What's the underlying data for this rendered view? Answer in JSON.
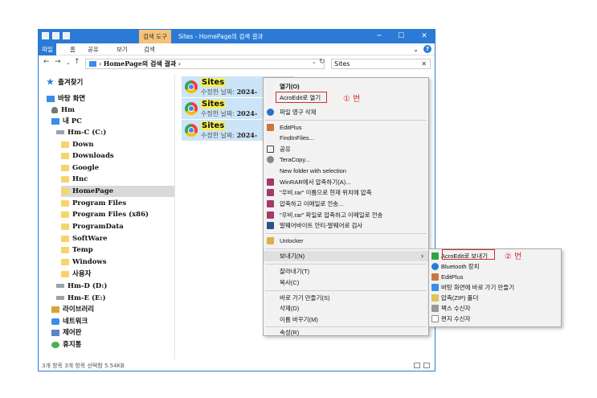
{
  "titlebar": {
    "context_tab": "검색 도구",
    "title": "Sites - HomePage의 검색 결과",
    "minimize": "─",
    "maximize": "☐",
    "close": "✕"
  },
  "ribbon": {
    "tabs": [
      "파일",
      "홈",
      "공유",
      "보기",
      "검색"
    ],
    "collapse": "⌄",
    "help": "?"
  },
  "address": {
    "back": "←",
    "forward": "→",
    "recent": "⌄",
    "up": "↑",
    "sep": "›",
    "folder": "HomePage의 검색 결과",
    "after": "›",
    "dropdown": "⌄",
    "refresh": "↻",
    "search_value": "Sites",
    "search_clear": "✕"
  },
  "nav": {
    "items": [
      {
        "label": "즐겨찾기"
      },
      {
        "label": "바탕 화면"
      },
      {
        "label": "Hm"
      },
      {
        "label": "내 PC"
      },
      {
        "label": "Hm-C (C:)"
      },
      {
        "label": "Down"
      },
      {
        "label": "Downloads"
      },
      {
        "label": "Google"
      },
      {
        "label": "Hnc"
      },
      {
        "label": "HomePage"
      },
      {
        "label": "Program Files"
      },
      {
        "label": "Program Files (x86)"
      },
      {
        "label": "ProgramData"
      },
      {
        "label": "SoftWare"
      },
      {
        "label": "Temp"
      },
      {
        "label": "Windows"
      },
      {
        "label": "사용자"
      },
      {
        "label": "Hm-D (D:)"
      },
      {
        "label": "Hm-E (E:)"
      },
      {
        "label": "라이브러리"
      },
      {
        "label": "네트워크"
      },
      {
        "label": "제어판"
      },
      {
        "label": "휴지통"
      }
    ]
  },
  "results": [
    {
      "name": "Sites",
      "meta_label": "수정한 날짜:",
      "meta_value": "2024-"
    },
    {
      "name": "Sites",
      "meta_label": "수정한 날짜:",
      "meta_value": "2024-"
    },
    {
      "name": "Sites",
      "meta_label": "수정한 날짜:",
      "meta_value": "2024-"
    }
  ],
  "status": {
    "text": "3개 항목   3개 항목 선택함 5.54KB"
  },
  "context_menu": {
    "items": [
      {
        "label": "열기(O)"
      },
      {
        "label": "AcroEdit로 열기"
      },
      {
        "label": "파일 영구 삭제"
      },
      {
        "label": "EditPlus"
      },
      {
        "label": "FindInFiles..."
      },
      {
        "label": "공유"
      },
      {
        "label": "TeraCopy..."
      },
      {
        "label": "New folder with selection"
      },
      {
        "label": "WinRAR에서 압축하기(A)..."
      },
      {
        "label": "\"우비.rar\" 이름으로 현재 위치에 압축"
      },
      {
        "label": "압축하고 이메일로 전송..."
      },
      {
        "label": "\"우비.rar\" 파일로 압축하고 이메일로 전송"
      },
      {
        "label": "말웨어바이트 안티-말웨어로 검사"
      },
      {
        "label": "Unlocker"
      },
      {
        "label": "보내기(N)",
        "arrow": "›"
      },
      {
        "label": "잘라내기(T)"
      },
      {
        "label": "복사(C)"
      },
      {
        "label": "바로 가기 만들기(S)"
      },
      {
        "label": "삭제(D)"
      },
      {
        "label": "이름 바꾸기(M)"
      },
      {
        "label": "속성(R)"
      }
    ],
    "annotation": "① 번"
  },
  "sendto_menu": {
    "items": [
      {
        "label": "AcroEdit로 보내기"
      },
      {
        "label": "Bluetooth 장치"
      },
      {
        "label": "EditPlus"
      },
      {
        "label": "바탕 화면에 바로 가기 만들기"
      },
      {
        "label": "압축(ZIP) 폴더"
      },
      {
        "label": "팩스 수신자"
      },
      {
        "label": "편지 수신자"
      }
    ],
    "annotation": "② 번"
  },
  "colors": {
    "accent": "#2b7ad6",
    "selection": "#cce4f7",
    "highlight_text": "#f5ef52",
    "annotation_red": "#d62b2b"
  }
}
